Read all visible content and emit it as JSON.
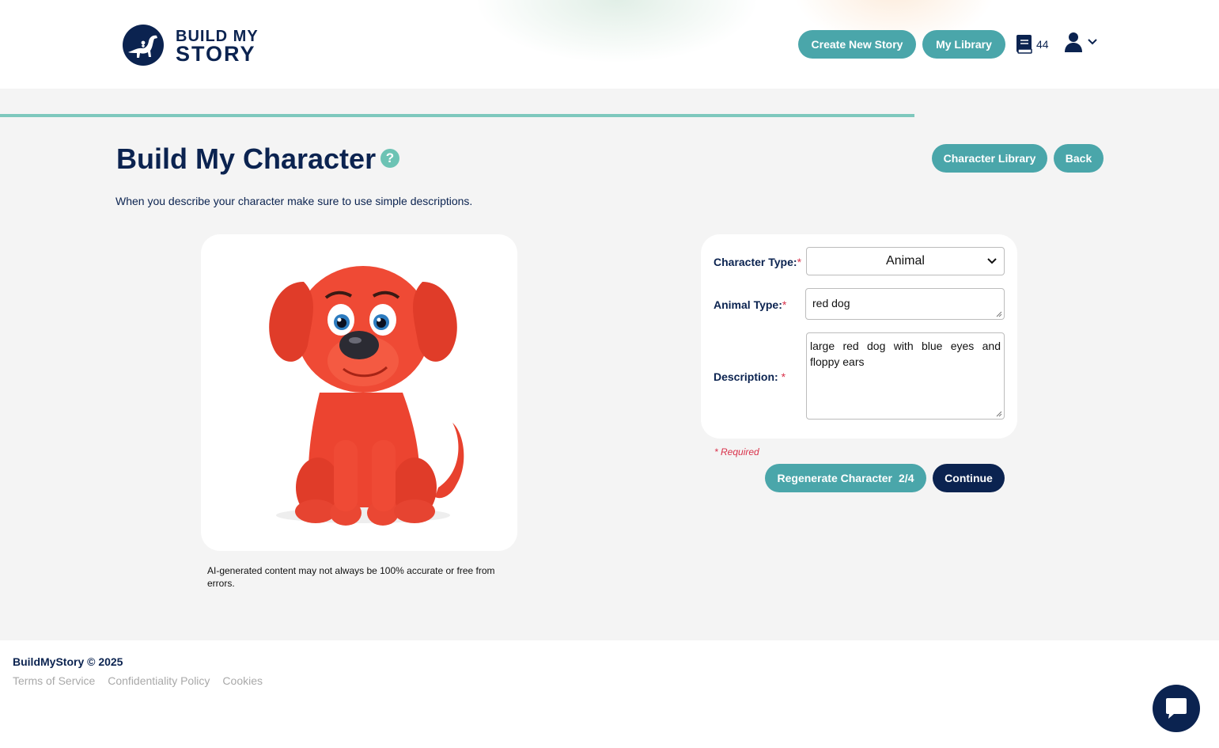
{
  "header": {
    "logo_line1": "BUILD MY",
    "logo_line2": "STORY",
    "create_story_label": "Create New Story",
    "my_library_label": "My Library",
    "book_count": "44",
    "book_icon": "book-icon",
    "user_icon": "user-icon"
  },
  "page": {
    "title": "Build My Character",
    "help_symbol": "?",
    "subtitle": "When you describe your character make sure to use simple descriptions.",
    "character_library_label": "Character Library",
    "back_label": "Back",
    "progress_fraction": 0.75
  },
  "image": {
    "disclaimer": "AI-generated content may not always be 100% accurate or free from errors."
  },
  "form": {
    "character_type_label": "Character Type:",
    "character_type_value": "Animal",
    "animal_type_label": "Animal Type:",
    "animal_type_value": "red dog",
    "description_label": "Description: ",
    "description_value": "large red dog with blue eyes and floppy ears",
    "required_star": "*",
    "required_note": "* Required",
    "regenerate_label": "Regenerate Character",
    "regenerate_count": "2/4",
    "continue_label": "Continue"
  },
  "footer": {
    "copyright": "BuildMyStory © 2025",
    "links": [
      "Terms of Service",
      "Confidentiality Policy",
      "Cookies"
    ]
  },
  "colors": {
    "navy": "#0b2350",
    "teal": "#4aa6aa",
    "progress": "#7ec8bd",
    "required": "#d9314a"
  }
}
